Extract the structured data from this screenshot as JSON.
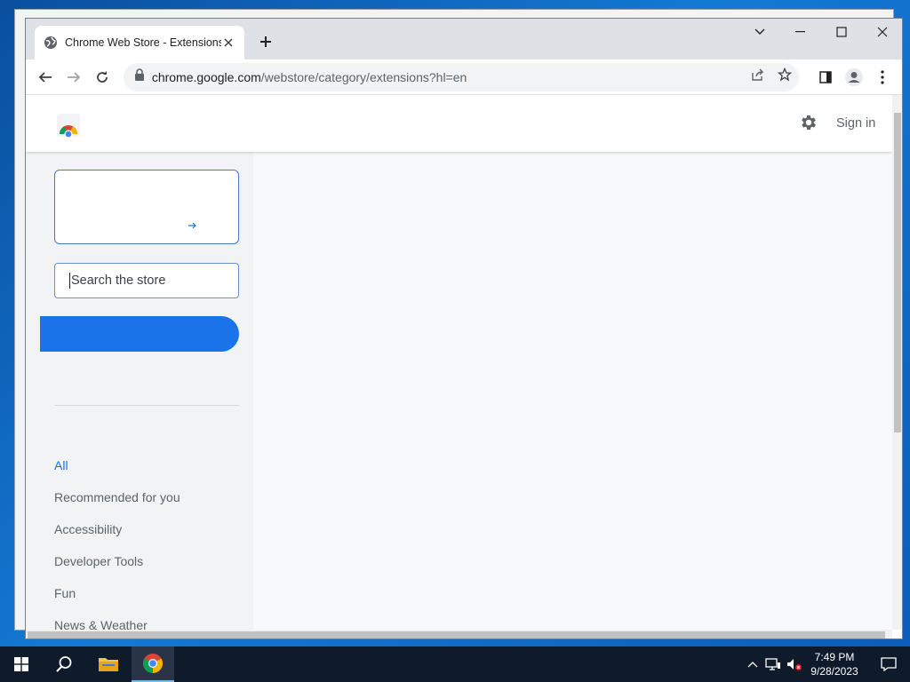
{
  "browser": {
    "tab": {
      "title": "Chrome Web Store - Extensions",
      "favicon": "globe-icon"
    },
    "url": {
      "host": "chrome.google.com",
      "path": "/webstore/category/extensions?hl=en"
    }
  },
  "header": {
    "sign_in_label": "Sign in"
  },
  "sidebar": {
    "search_placeholder": "Search the store",
    "categories": [
      {
        "label": "All",
        "active": true
      },
      {
        "label": "Recommended for you"
      },
      {
        "label": "Accessibility"
      },
      {
        "label": "Developer Tools"
      },
      {
        "label": "Fun"
      },
      {
        "label": "News & Weather"
      }
    ]
  },
  "taskbar": {
    "time": "7:49 PM",
    "date": "9/28/2023"
  },
  "colors": {
    "accent": "#1a73e8",
    "taskbar": "#0f1a2b"
  }
}
